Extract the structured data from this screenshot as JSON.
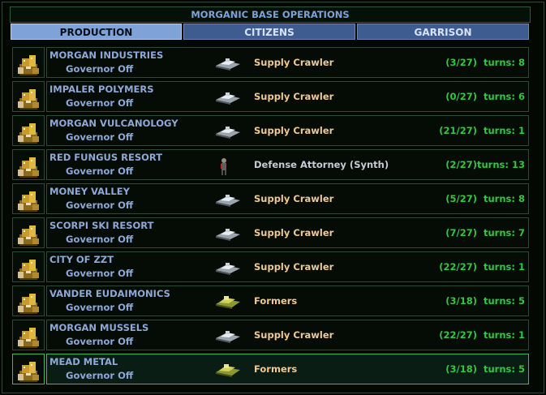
{
  "window": {
    "title": "MORGANIC BASE OPERATIONS"
  },
  "tabs": [
    {
      "label": "PRODUCTION",
      "active": true
    },
    {
      "label": "CITIZENS",
      "active": false
    },
    {
      "label": "GARRISON",
      "active": false
    }
  ],
  "colors": {
    "base_text": "#8ea8d8",
    "unit_text": "#f0c890",
    "other_text": "#c6ccd6",
    "progress_text": "#2fc840",
    "selected_border": "#3cb860"
  },
  "bases": [
    {
      "name": "MORGAN INDUSTRIES",
      "governor": "Governor Off",
      "build": "Supply Crawler",
      "build_icon": "supply-crawler-icon",
      "progress": "(3/27)",
      "turns_label": "turns:",
      "turns": "8"
    },
    {
      "name": "IMPALER POLYMERS",
      "governor": "Governor Off",
      "build": "Supply Crawler",
      "build_icon": "supply-crawler-icon",
      "progress": "(0/27)",
      "turns_label": "turns:",
      "turns": "6"
    },
    {
      "name": "MORGAN VULCANOLOGY",
      "governor": "Governor Off",
      "build": "Supply Crawler",
      "build_icon": "supply-crawler-icon",
      "progress": "(21/27)",
      "turns_label": "turns:",
      "turns": "1"
    },
    {
      "name": "RED FUNGUS RESORT",
      "governor": "Governor Off",
      "build": "Defense Attorney (Synth)",
      "build_icon": "defense-attorney-icon",
      "progress": "(2/27)",
      "turns_label": "turns:",
      "turns": "13"
    },
    {
      "name": "MONEY VALLEY",
      "governor": "Governor Off",
      "build": "Supply Crawler",
      "build_icon": "supply-crawler-icon",
      "progress": "(5/27)",
      "turns_label": "turns:",
      "turns": "8"
    },
    {
      "name": "SCORPI SKI RESORT",
      "governor": "Governor Off",
      "build": "Supply Crawler",
      "build_icon": "supply-crawler-icon",
      "progress": "(7/27)",
      "turns_label": "turns:",
      "turns": "7"
    },
    {
      "name": "CITY OF ZZT",
      "governor": "Governor Off",
      "build": "Supply Crawler",
      "build_icon": "supply-crawler-icon",
      "progress": "(22/27)",
      "turns_label": "turns:",
      "turns": "1"
    },
    {
      "name": "VANDER EUDAIMONICS",
      "governor": "Governor Off",
      "build": "Formers",
      "build_icon": "formers-icon",
      "progress": "(3/18)",
      "turns_label": "turns:",
      "turns": "5"
    },
    {
      "name": "MORGAN MUSSELS",
      "governor": "Governor Off",
      "build": "Supply Crawler",
      "build_icon": "supply-crawler-icon",
      "progress": "(22/27)",
      "turns_label": "turns:",
      "turns": "1"
    },
    {
      "name": "MEAD METAL",
      "governor": "Governor Off",
      "build": "Formers",
      "build_icon": "formers-icon",
      "progress": "(3/18)",
      "turns_label": "turns:",
      "turns": "5",
      "selected": true
    }
  ]
}
